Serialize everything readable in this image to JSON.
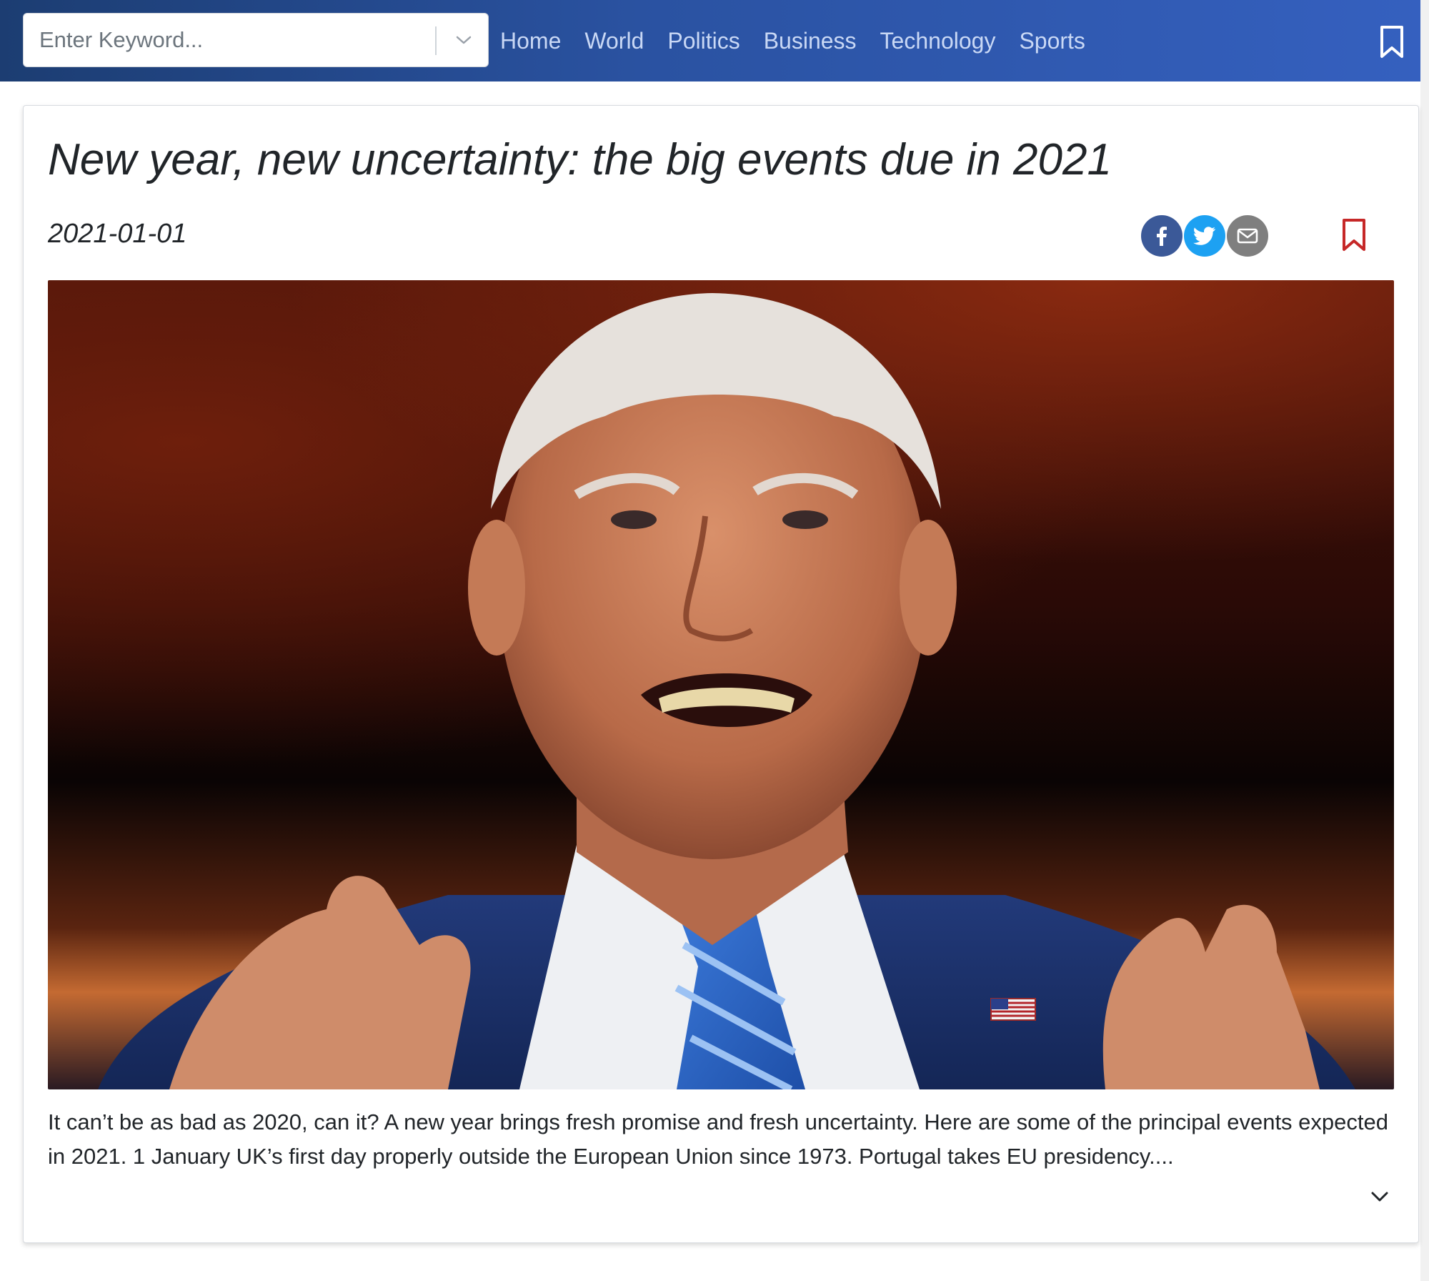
{
  "search": {
    "placeholder": "Enter Keyword...",
    "value": ""
  },
  "nav": {
    "links": [
      "Home",
      "World",
      "Politics",
      "Business",
      "Technology",
      "Sports"
    ]
  },
  "article": {
    "title": "New year, new uncertainty: the big events due in 2021",
    "date": "2021-01-01",
    "excerpt": "It can’t be as bad as 2020, can it? A new year brings fresh promise and fresh uncertainty. Here are some of the principal events expected in 2021. 1 January UK’s first day properly outside the European Union since 1973. Portugal takes EU presidency...."
  },
  "icons": {
    "dropdown": "chevron-down-icon",
    "nav_bookmark": "bookmark-icon",
    "share": [
      "facebook-icon",
      "twitter-icon",
      "email-icon"
    ],
    "card_bookmark": "bookmark-icon",
    "expand": "chevron-down-icon"
  },
  "colors": {
    "nav_gradient_start": "#1c3d72",
    "nav_gradient_end": "#3560bf",
    "nav_link": "#c9d8f5",
    "facebook": "#3b5998",
    "twitter": "#1da1f2",
    "email": "#7f7f7f",
    "bookmark_accent": "#c62828"
  }
}
